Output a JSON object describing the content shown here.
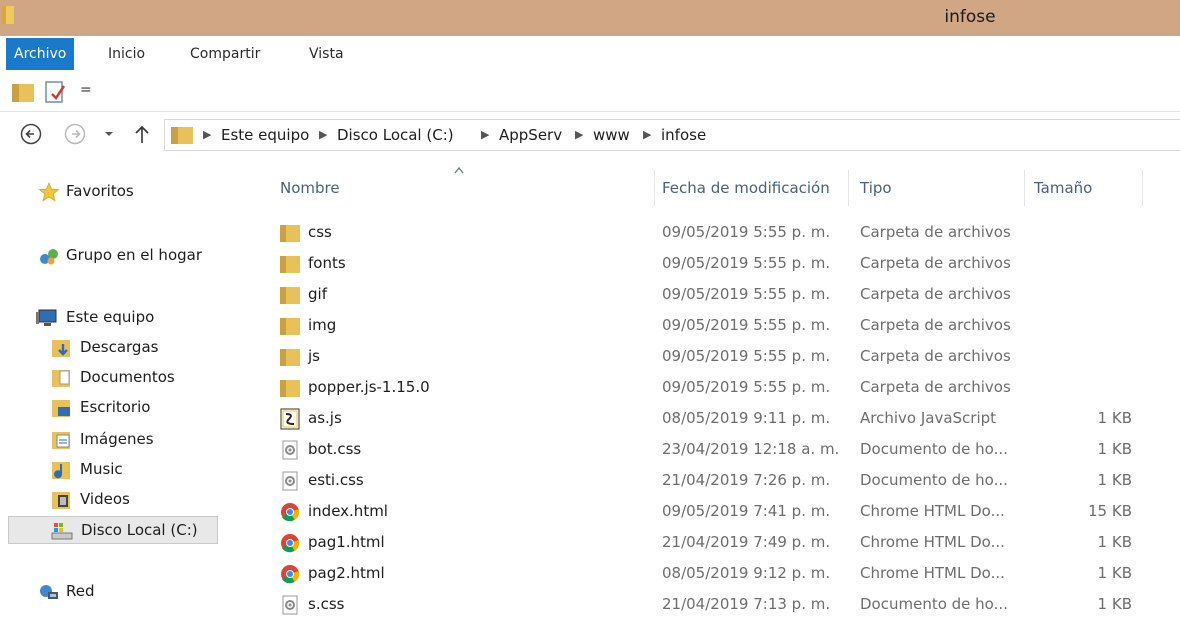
{
  "window": {
    "title": "infose"
  },
  "ribbon": {
    "tabs": [
      {
        "label": "Archivo"
      },
      {
        "label": "Inicio"
      },
      {
        "label": "Compartir"
      },
      {
        "label": "Vista"
      }
    ]
  },
  "qat": {
    "dropdown_glyph": "="
  },
  "address": {
    "crumbs": [
      "Este equipo",
      "Disco Local (C:)",
      "AppServ",
      "www",
      "infose"
    ]
  },
  "nav": {
    "items": [
      {
        "label": "Favoritos",
        "icon": "star-icon"
      },
      {
        "label": "Grupo en el hogar",
        "icon": "homegroup-icon"
      },
      {
        "label": "Este equipo",
        "icon": "computer-icon"
      },
      {
        "label": "Descargas",
        "icon": "downloads-icon"
      },
      {
        "label": "Documentos",
        "icon": "documents-icon"
      },
      {
        "label": "Escritorio",
        "icon": "desktop-icon"
      },
      {
        "label": "Imágenes",
        "icon": "pictures-icon"
      },
      {
        "label": "Music",
        "icon": "music-icon"
      },
      {
        "label": "Videos",
        "icon": "videos-icon"
      },
      {
        "label": "Disco Local (C:)",
        "icon": "drive-icon",
        "selected": true
      },
      {
        "label": "Red",
        "icon": "network-icon"
      }
    ]
  },
  "columns": {
    "name": "Nombre",
    "date": "Fecha de modificación",
    "type": "Tipo",
    "size": "Tamaño",
    "sort_glyph": "^"
  },
  "files": [
    {
      "name": "css",
      "date": "09/05/2019 5:55 p. m.",
      "type": "Carpeta de archivos",
      "size": "",
      "icon": "folder-icon"
    },
    {
      "name": "fonts",
      "date": "09/05/2019 5:55 p. m.",
      "type": "Carpeta de archivos",
      "size": "",
      "icon": "folder-icon"
    },
    {
      "name": "gif",
      "date": "09/05/2019 5:55 p. m.",
      "type": "Carpeta de archivos",
      "size": "",
      "icon": "folder-icon"
    },
    {
      "name": "img",
      "date": "09/05/2019 5:55 p. m.",
      "type": "Carpeta de archivos",
      "size": "",
      "icon": "folder-icon"
    },
    {
      "name": "js",
      "date": "09/05/2019 5:55 p. m.",
      "type": "Carpeta de archivos",
      "size": "",
      "icon": "folder-icon"
    },
    {
      "name": "popper.js-1.15.0",
      "date": "09/05/2019 5:55 p. m.",
      "type": "Carpeta de archivos",
      "size": "",
      "icon": "folder-icon"
    },
    {
      "name": "as.js",
      "date": "08/05/2019 9:11 p. m.",
      "type": "Archivo JavaScript",
      "size": "1 KB",
      "icon": "javascript-file-icon"
    },
    {
      "name": "bot.css",
      "date": "23/04/2019 12:18 a. m.",
      "type": "Documento de ho...",
      "size": "1 KB",
      "icon": "css-file-icon"
    },
    {
      "name": "esti.css",
      "date": "21/04/2019 7:26 p. m.",
      "type": "Documento de ho...",
      "size": "1 KB",
      "icon": "css-file-icon"
    },
    {
      "name": "index.html",
      "date": "09/05/2019 7:41 p. m.",
      "type": "Chrome HTML Do...",
      "size": "15 KB",
      "icon": "chrome-html-icon"
    },
    {
      "name": "pag1.html",
      "date": "21/04/2019 7:49 p. m.",
      "type": "Chrome HTML Do...",
      "size": "1 KB",
      "icon": "chrome-html-icon"
    },
    {
      "name": "pag2.html",
      "date": "08/05/2019 9:12 p. m.",
      "type": "Chrome HTML Do...",
      "size": "1 KB",
      "icon": "chrome-html-icon"
    },
    {
      "name": "s.css",
      "date": "21/04/2019 7:13 p. m.",
      "type": "Documento de ho...",
      "size": "1 KB",
      "icon": "css-file-icon"
    }
  ],
  "colors": {
    "titlebar": "#d1a684",
    "active_tab": "#1979ca",
    "folder": "#e8c15a",
    "header_text": "#4c607a"
  }
}
